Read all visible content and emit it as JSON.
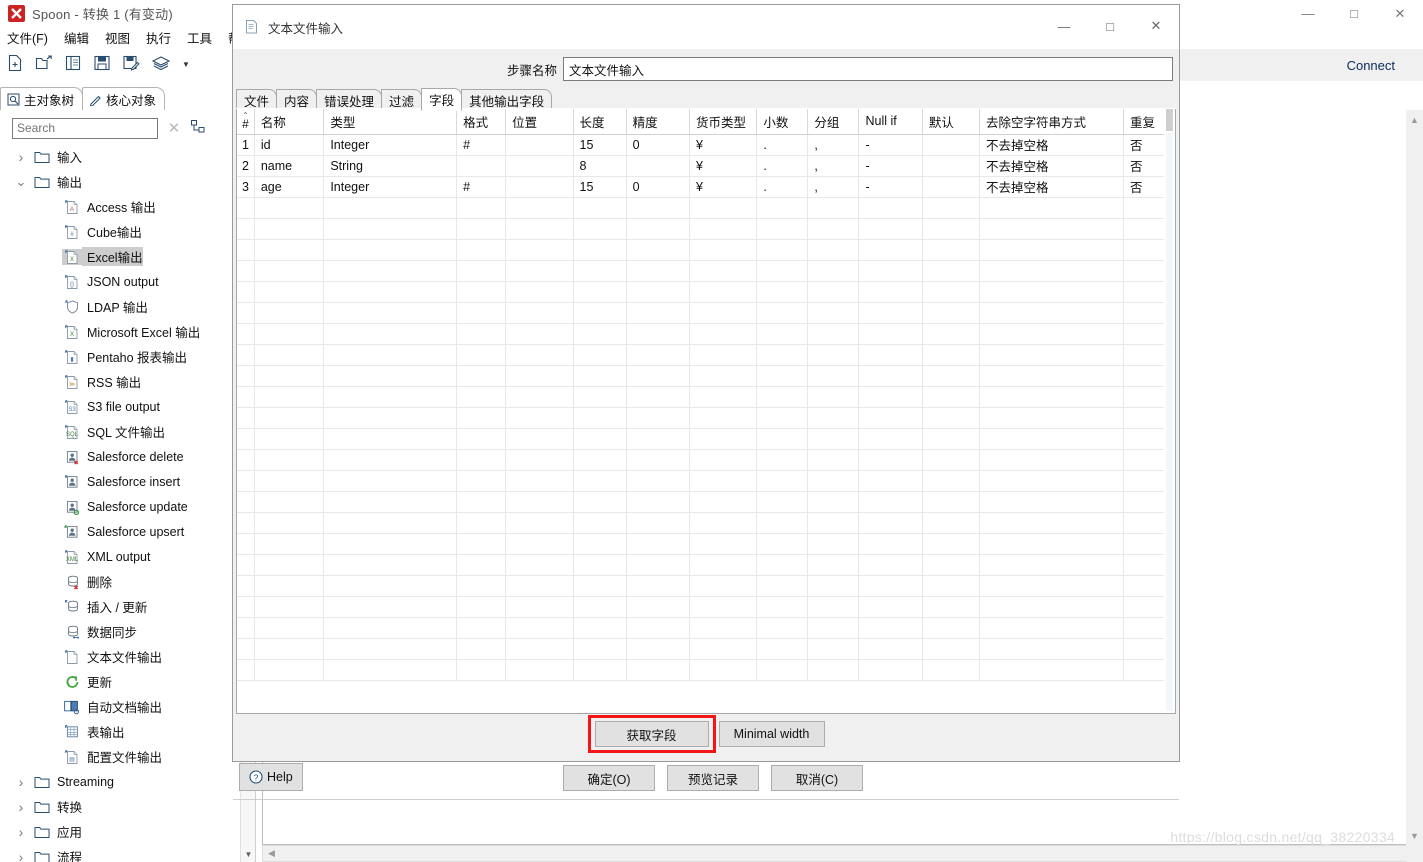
{
  "main_window": {
    "title": "Spoon - 转换 1 (有变动)",
    "app_icon": "spoon-icon",
    "window_controls": {
      "minimize": "—",
      "maximize": "□",
      "close": "✕"
    },
    "menu": [
      {
        "label": "文件(F)"
      },
      {
        "label": "编辑"
      },
      {
        "label": "视图"
      },
      {
        "label": "执行"
      },
      {
        "label": "工具"
      },
      {
        "label": "帮助"
      }
    ],
    "toolbar": [
      {
        "name": "new-file-icon"
      },
      {
        "name": "open-file-icon"
      },
      {
        "name": "explore-icon"
      },
      {
        "name": "save-icon"
      },
      {
        "name": "save-as-icon"
      },
      {
        "name": "layers-icon"
      },
      {
        "name": "dropdown-caret-icon"
      }
    ],
    "perspective_tabs": [
      {
        "label": "主对象树",
        "icon": "tree-icon",
        "active": true
      },
      {
        "label": "核心对象",
        "icon": "pencil-icon",
        "active": false
      }
    ],
    "connect_label": "Connect",
    "watermark": "https://blog.csdn.net/qq_38220334"
  },
  "tree_panel": {
    "search": {
      "value": "",
      "placeholder": "Search"
    },
    "clear_icon": "clear-x-icon",
    "tool_icon": "expand-collapse-icon",
    "nodes": [
      {
        "label": "输入",
        "depth": 1,
        "type": "folder",
        "expanded": false,
        "selected": false
      },
      {
        "label": "输出",
        "depth": 1,
        "type": "folder",
        "expanded": true,
        "selected": false
      },
      {
        "label": "Access 输出",
        "depth": 2,
        "type": "step",
        "icon": "access-output-icon",
        "selected": false
      },
      {
        "label": "Cube输出",
        "depth": 2,
        "type": "step",
        "icon": "cube-output-icon",
        "selected": false
      },
      {
        "label": "Excel输出",
        "depth": 2,
        "type": "step",
        "icon": "excel-output-icon",
        "selected": true
      },
      {
        "label": "JSON output",
        "depth": 2,
        "type": "step",
        "icon": "json-output-icon",
        "selected": false
      },
      {
        "label": "LDAP 输出",
        "depth": 2,
        "type": "step",
        "icon": "ldap-output-icon",
        "selected": false
      },
      {
        "label": "Microsoft Excel 输出",
        "depth": 2,
        "type": "step",
        "icon": "ms-excel-output-icon",
        "selected": false
      },
      {
        "label": "Pentaho 报表输出",
        "depth": 2,
        "type": "step",
        "icon": "pentaho-report-output-icon",
        "selected": false
      },
      {
        "label": "RSS 输出",
        "depth": 2,
        "type": "step",
        "icon": "rss-output-icon",
        "selected": false
      },
      {
        "label": "S3 file output",
        "depth": 2,
        "type": "step",
        "icon": "s3-file-output-icon",
        "selected": false
      },
      {
        "label": "SQL 文件输出",
        "depth": 2,
        "type": "step",
        "icon": "sql-file-output-icon",
        "selected": false
      },
      {
        "label": "Salesforce delete",
        "depth": 2,
        "type": "step",
        "icon": "salesforce-delete-icon",
        "selected": false
      },
      {
        "label": "Salesforce insert",
        "depth": 2,
        "type": "step",
        "icon": "salesforce-insert-icon",
        "selected": false
      },
      {
        "label": "Salesforce update",
        "depth": 2,
        "type": "step",
        "icon": "salesforce-update-icon",
        "selected": false
      },
      {
        "label": "Salesforce upsert",
        "depth": 2,
        "type": "step",
        "icon": "salesforce-upsert-icon",
        "selected": false
      },
      {
        "label": "XML output",
        "depth": 2,
        "type": "step",
        "icon": "xml-output-icon",
        "selected": false
      },
      {
        "label": "删除",
        "depth": 2,
        "type": "step",
        "icon": "delete-icon",
        "selected": false
      },
      {
        "label": "插入 / 更新",
        "depth": 2,
        "type": "step",
        "icon": "insert-update-icon",
        "selected": false
      },
      {
        "label": "数据同步",
        "depth": 2,
        "type": "step",
        "icon": "data-sync-icon",
        "selected": false
      },
      {
        "label": "文本文件输出",
        "depth": 2,
        "type": "step",
        "icon": "text-file-output-icon",
        "selected": false
      },
      {
        "label": "更新",
        "depth": 2,
        "type": "step",
        "icon": "update-icon",
        "selected": false
      },
      {
        "label": "自动文档输出",
        "depth": 2,
        "type": "step",
        "icon": "auto-doc-output-icon",
        "selected": false
      },
      {
        "label": "表输出",
        "depth": 2,
        "type": "step",
        "icon": "table-output-icon",
        "selected": false
      },
      {
        "label": "配置文件输出",
        "depth": 2,
        "type": "step",
        "icon": "properties-output-icon",
        "selected": false
      },
      {
        "label": "Streaming",
        "depth": 1,
        "type": "folder",
        "expanded": false,
        "selected": false
      },
      {
        "label": "转换",
        "depth": 1,
        "type": "folder",
        "expanded": false,
        "selected": false
      },
      {
        "label": "应用",
        "depth": 1,
        "type": "folder",
        "expanded": false,
        "selected": false
      },
      {
        "label": "流程",
        "depth": 1,
        "type": "folder",
        "expanded": false,
        "selected": false
      }
    ]
  },
  "dialog": {
    "title": "文本文件输入",
    "title_icon": "text-file-input-icon",
    "window_controls": {
      "minimize": "—",
      "maximize": "□",
      "close": "✕"
    },
    "step_name": {
      "label": "步骤名称",
      "value": "文本文件输入"
    },
    "tabs": [
      {
        "label": "文件",
        "active": false
      },
      {
        "label": "内容",
        "active": false
      },
      {
        "label": "错误处理",
        "active": false
      },
      {
        "label": "过滤",
        "active": false
      },
      {
        "label": "字段",
        "active": true
      },
      {
        "label": "其他输出字段",
        "active": false
      }
    ],
    "table": {
      "columns": [
        "#",
        "名称",
        "类型",
        "格式",
        "位置",
        "长度",
        "精度",
        "货币类型",
        "小数",
        "分组",
        "Null if",
        "默认",
        "去除空字符串方式",
        "重复"
      ],
      "rows": [
        {
          "index": "1",
          "名称": "id",
          "类型": "Integer",
          "格式": "#",
          "位置": "",
          "长度": "15",
          "精度": "0",
          "货币类型": "¥",
          "小数": ".",
          "分组": ",",
          "Null if": "-",
          "默认": "",
          "去除空字符串方式": "不去掉空格",
          "重复": "否"
        },
        {
          "index": "2",
          "名称": "name",
          "类型": "String",
          "格式": "",
          "位置": "",
          "长度": "8",
          "精度": "",
          "货币类型": "¥",
          "小数": ".",
          "分组": ",",
          "Null if": "-",
          "默认": "",
          "去除空字符串方式": "不去掉空格",
          "重复": "否"
        },
        {
          "index": "3",
          "名称": "age",
          "类型": "Integer",
          "格式": "#",
          "位置": "",
          "长度": "15",
          "精度": "0",
          "货币类型": "¥",
          "小数": ".",
          "分组": ",",
          "Null if": "-",
          "默认": "",
          "去除空字符串方式": "不去掉空格",
          "重复": "否"
        }
      ],
      "empty_row_count": 23
    },
    "field_buttons": {
      "get_fields": "获取字段",
      "minimal_width": "Minimal width",
      "highlight_color": "#f21616"
    },
    "footer": {
      "help": "Help",
      "help_icon": "question-circle-icon",
      "ok": "确定(O)",
      "preview": "预览记录",
      "cancel": "取消(C)"
    }
  }
}
